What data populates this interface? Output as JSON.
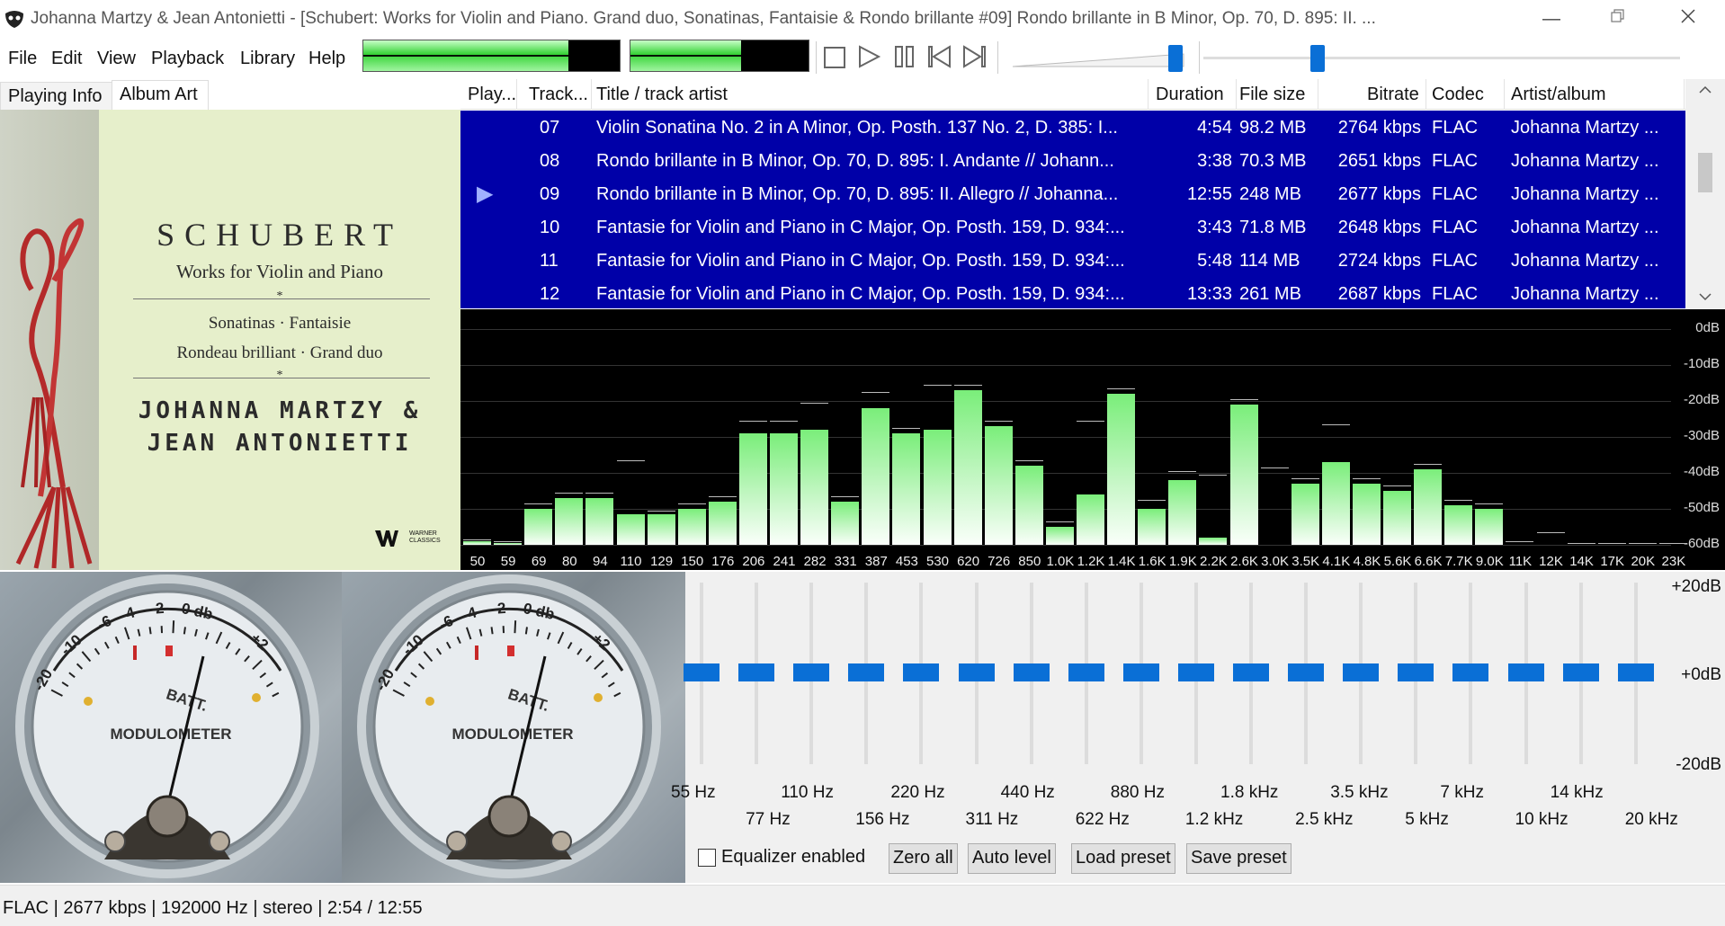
{
  "window": {
    "title": "Johanna Martzy & Jean Antonietti - [Schubert: Works for Violin and Piano. Grand duo, Sonatinas, Fantaisie & Rondo brillante #09] Rondo brillante in B Minor, Op. 70, D. 895: II. ..."
  },
  "menu": [
    "File",
    "Edit",
    "View",
    "Playback",
    "Library",
    "Help"
  ],
  "toolbar": {
    "peak_meter_left_level": 0.8,
    "peak_meter_right_level": 0.62,
    "volume_level": 0.95,
    "seek_position": 0.23
  },
  "tabs": [
    "Playing Info",
    "Album Art"
  ],
  "album_art": {
    "composer": "SCHUBERT",
    "subtitle": "Works for Violin and Piano",
    "star": "*",
    "line1": "Sonatinas · Fantaisie",
    "line2": "Rondeau brilliant · Grand duo",
    "artist1": "JOHANNA MARTZY &",
    "artist2": "JEAN ANTONIETTI",
    "label": "WARNER CLASSICS"
  },
  "playlist": {
    "columns": [
      "Play...",
      "Track...",
      "Title / track artist",
      "Duration",
      "File size",
      "Bitrate",
      "Codec",
      "Artist/album"
    ],
    "rows": [
      {
        "playing": "",
        "track": "07",
        "title": "Violin Sonatina No. 2 in A Minor, Op. Posth. 137 No. 2, D. 385: I...",
        "duration": "4:54",
        "size": "98.2 MB",
        "bitrate": "2764 kbps",
        "codec": "FLAC",
        "artist": "Johanna Martzy ..."
      },
      {
        "playing": "",
        "track": "08",
        "title": "Rondo brillante in B Minor, Op. 70, D. 895: I. Andante // Johann...",
        "duration": "3:38",
        "size": "70.3 MB",
        "bitrate": "2651 kbps",
        "codec": "FLAC",
        "artist": "Johanna Martzy ..."
      },
      {
        "playing": "▶",
        "track": "09",
        "title": "Rondo brillante in B Minor, Op. 70, D. 895: II. Allegro // Johanna...",
        "duration": "12:55",
        "size": "248 MB",
        "bitrate": "2677 kbps",
        "codec": "FLAC",
        "artist": "Johanna Martzy ..."
      },
      {
        "playing": "",
        "track": "10",
        "title": "Fantasie for Violin and Piano in C Major, Op. Posth. 159, D. 934:...",
        "duration": "3:43",
        "size": "71.8 MB",
        "bitrate": "2648 kbps",
        "codec": "FLAC",
        "artist": "Johanna Martzy ..."
      },
      {
        "playing": "",
        "track": "11",
        "title": "Fantasie for Violin and Piano in C Major, Op. Posth. 159, D. 934:...",
        "duration": "5:48",
        "size": "114 MB",
        "bitrate": "2724 kbps",
        "codec": "FLAC",
        "artist": "Johanna Martzy ..."
      },
      {
        "playing": "",
        "track": "12",
        "title": "Fantasie for Violin and Piano in C Major, Op. Posth. 159, D. 934:...",
        "duration": "13:33",
        "size": "261 MB",
        "bitrate": "2687 kbps",
        "codec": "FLAC",
        "artist": "Johanna Martzy ..."
      }
    ]
  },
  "spectrum": {
    "db_labels": [
      "0dB",
      "-10dB",
      "-20dB",
      "-30dB",
      "-40dB",
      "-50dB",
      "-60dB"
    ],
    "freq_labels": [
      "50",
      "59",
      "69",
      "80",
      "94",
      "110",
      "129",
      "150",
      "176",
      "206",
      "241",
      "282",
      "331",
      "387",
      "453",
      "530",
      "620",
      "726",
      "850",
      "1.0K",
      "1.2K",
      "1.4K",
      "1.6K",
      "1.9K",
      "2.2K",
      "2.6K",
      "3.0K",
      "3.5K",
      "4.1K",
      "4.8K",
      "5.6K",
      "6.6K",
      "7.7K",
      "9.0K",
      "11K",
      "12K",
      "14K",
      "17K",
      "20K",
      "23K"
    ],
    "levels_db": [
      -59,
      -59.5,
      -50,
      -47,
      -47,
      -51.5,
      -51.5,
      -50,
      -48,
      -29,
      -29,
      -28,
      -48,
      -22,
      -29,
      -28,
      -17,
      -27,
      -38,
      -55,
      -46,
      -18,
      -50,
      -42,
      -58,
      -21,
      -60,
      -43,
      -37,
      -43,
      -45,
      -39,
      -49,
      -50,
      -60,
      -60,
      -60,
      -60,
      -60,
      -60
    ],
    "peaks_db": [
      -59,
      -59.5,
      -49,
      -46,
      -46,
      -37,
      -51,
      -49,
      -47,
      -26,
      -26,
      -21,
      -47,
      -18,
      -28,
      -16,
      -16,
      -26,
      -37,
      -54,
      -26,
      -17,
      -48,
      -40,
      -41,
      -20,
      -39,
      -42,
      -27,
      -42,
      -44,
      -38,
      -48,
      -49,
      -59.5,
      -57,
      -60,
      -60,
      -60,
      -60
    ]
  },
  "vu_meters": [
    {
      "scale": [
        "-20",
        "-10",
        "-6",
        "-4",
        "-2",
        "0 db",
        "+2"
      ],
      "brand": "MODULOMETER",
      "batt": "BATT."
    },
    {
      "scale": [
        "-20",
        "-10",
        "-6",
        "-4",
        "-2",
        "0 db",
        "+2"
      ],
      "brand": "MODULOMETER",
      "batt": "BATT."
    }
  ],
  "equalizer": {
    "db_labels": [
      "+20dB",
      "+0dB",
      "-20dB"
    ],
    "bands": [
      "55 Hz",
      "77 Hz",
      "110 Hz",
      "156 Hz",
      "220 Hz",
      "311 Hz",
      "440 Hz",
      "622 Hz",
      "880 Hz",
      "1.2 kHz",
      "1.8 kHz",
      "2.5 kHz",
      "3.5 kHz",
      "5 kHz",
      "7 kHz",
      "10 kHz",
      "14 kHz",
      "20 kHz"
    ],
    "gains_db": [
      0,
      0,
      0,
      0,
      0,
      0,
      0,
      0,
      0,
      0,
      0,
      0,
      0,
      0,
      0,
      0,
      0,
      0
    ],
    "enabled_label": "Equalizer enabled",
    "enabled": false,
    "buttons": [
      "Zero all",
      "Auto level",
      "Load preset",
      "Save preset"
    ]
  },
  "status": "FLAC | 2677 kbps | 192000 Hz | stereo | 2:54 / 12:55",
  "colors": {
    "selection": "#0000a8",
    "accent": "#0a6fd6",
    "spectrum_bar": "#7aee7a"
  }
}
